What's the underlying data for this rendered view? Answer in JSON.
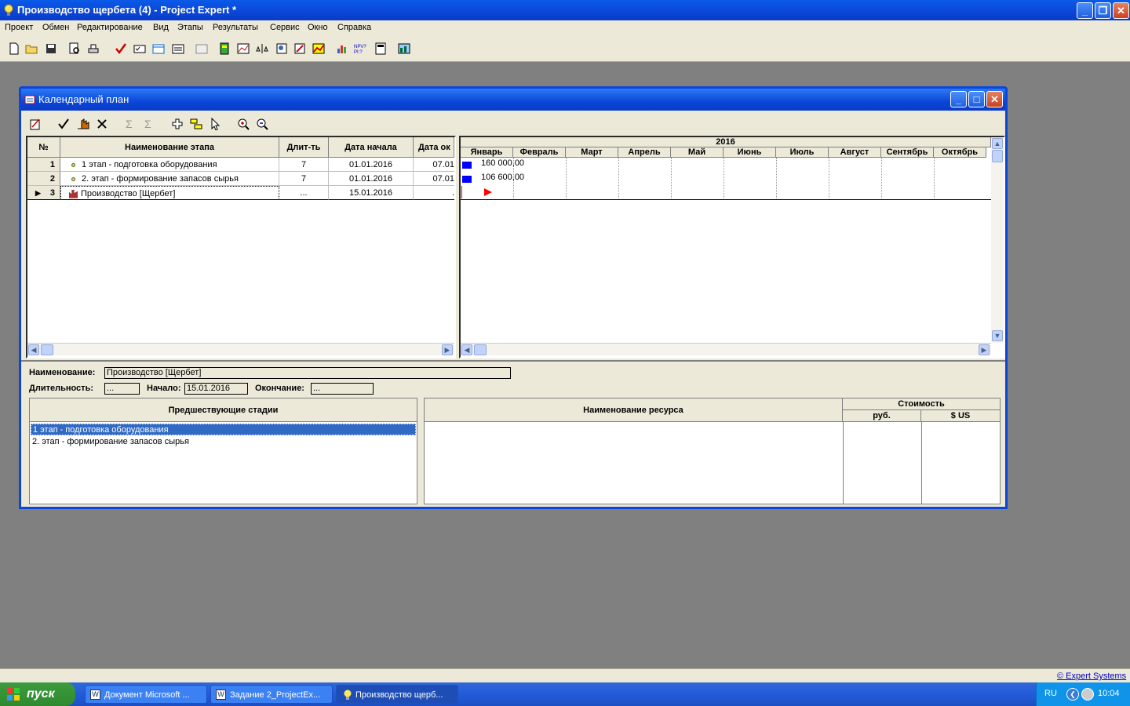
{
  "window": {
    "title": "Производство щербета (4) - Project Expert *"
  },
  "menu": [
    "Проект",
    "Обмен",
    "Редактирование",
    "Вид",
    "Этапы",
    "Результаты",
    "Сервис",
    "Окно",
    "Справка"
  ],
  "child": {
    "title": "Календарный план",
    "grid": {
      "headers": [
        "№",
        "Наименование этапа",
        "Длит-ть",
        "Дата начала",
        "Дата ок"
      ],
      "rows": [
        {
          "num": "1",
          "name": "1 этап - подготовка оборудования",
          "dur": "7",
          "start": "01.01.2016",
          "end": "07.01"
        },
        {
          "num": "2",
          "name": "2. этап - формирование запасов сырья",
          "dur": "7",
          "start": "01.01.2016",
          "end": "07.01"
        },
        {
          "num": "3",
          "name": "Производство [Щербет]",
          "dur": "...",
          "start": "15.01.2016",
          "end": "."
        }
      ]
    },
    "gantt": {
      "year": "2016",
      "months": [
        "Январь",
        "Февраль",
        "Март",
        "Апрель",
        "Май",
        "Июнь",
        "Июль",
        "Август",
        "Сентябрь",
        "Октябрь"
      ],
      "bars": [
        "160 000,00",
        "106 600,00"
      ],
      "bar_color": "#0000ff",
      "milestone_color": "#ff0000"
    },
    "detail": {
      "name_label": "Наименование:",
      "name_value": "Производство [Щербет]",
      "duration_label": "Длительность:",
      "duration_value": "...",
      "start_label": "Начало:",
      "start_value": "15.01.2016",
      "end_label": "Окончание:",
      "end_value": "...",
      "predecessors_header": "Предшествующие стадии",
      "predecessors": [
        "1 этап - подготовка оборудования",
        "2. этап - формирование запасов сырья"
      ],
      "resource_header": "Наименование ресурса",
      "cost_header": "Стоимость",
      "cost_rub": "руб.",
      "cost_usd": "$ US"
    }
  },
  "status": {
    "link": "© Expert Systems"
  },
  "taskbar": {
    "start": "пуск",
    "tasks": [
      "Документ Microsoft ...",
      "Задание 2_ProjectEx...",
      "Производство щерб..."
    ],
    "lang": "RU",
    "time": "10:04"
  }
}
